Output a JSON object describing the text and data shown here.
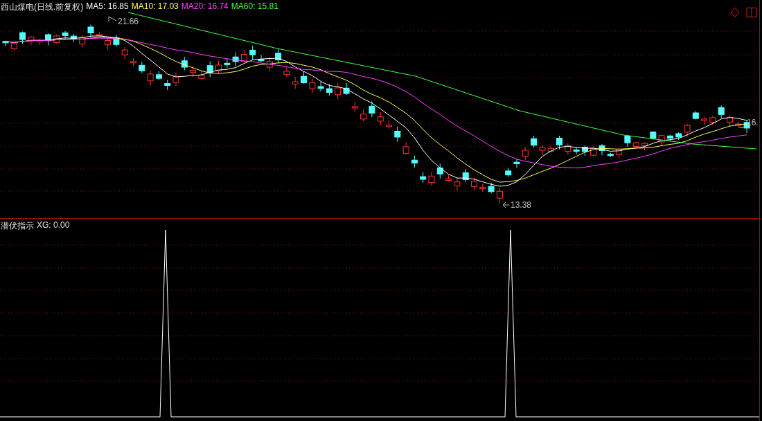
{
  "price_panel": {
    "title": "西山煤电(日线.前复权)",
    "moving_averages": [
      {
        "label": "MA5: 16.85",
        "color": "#ffffff"
      },
      {
        "label": "MA10: 17.03",
        "color": "#ffff55"
      },
      {
        "label": "MA20: 16.74",
        "color": "#ff44ff"
      },
      {
        "label": "MA60: 15.81",
        "color": "#44ff44"
      }
    ],
    "annotations": [
      {
        "kind": "high",
        "text": "21.66"
      },
      {
        "kind": "low",
        "text": "13.38"
      },
      {
        "kind": "last",
        "text": "16."
      }
    ]
  },
  "indicator_panel": {
    "title": "潜伏指示",
    "reading": "XG: 0.00"
  }
}
